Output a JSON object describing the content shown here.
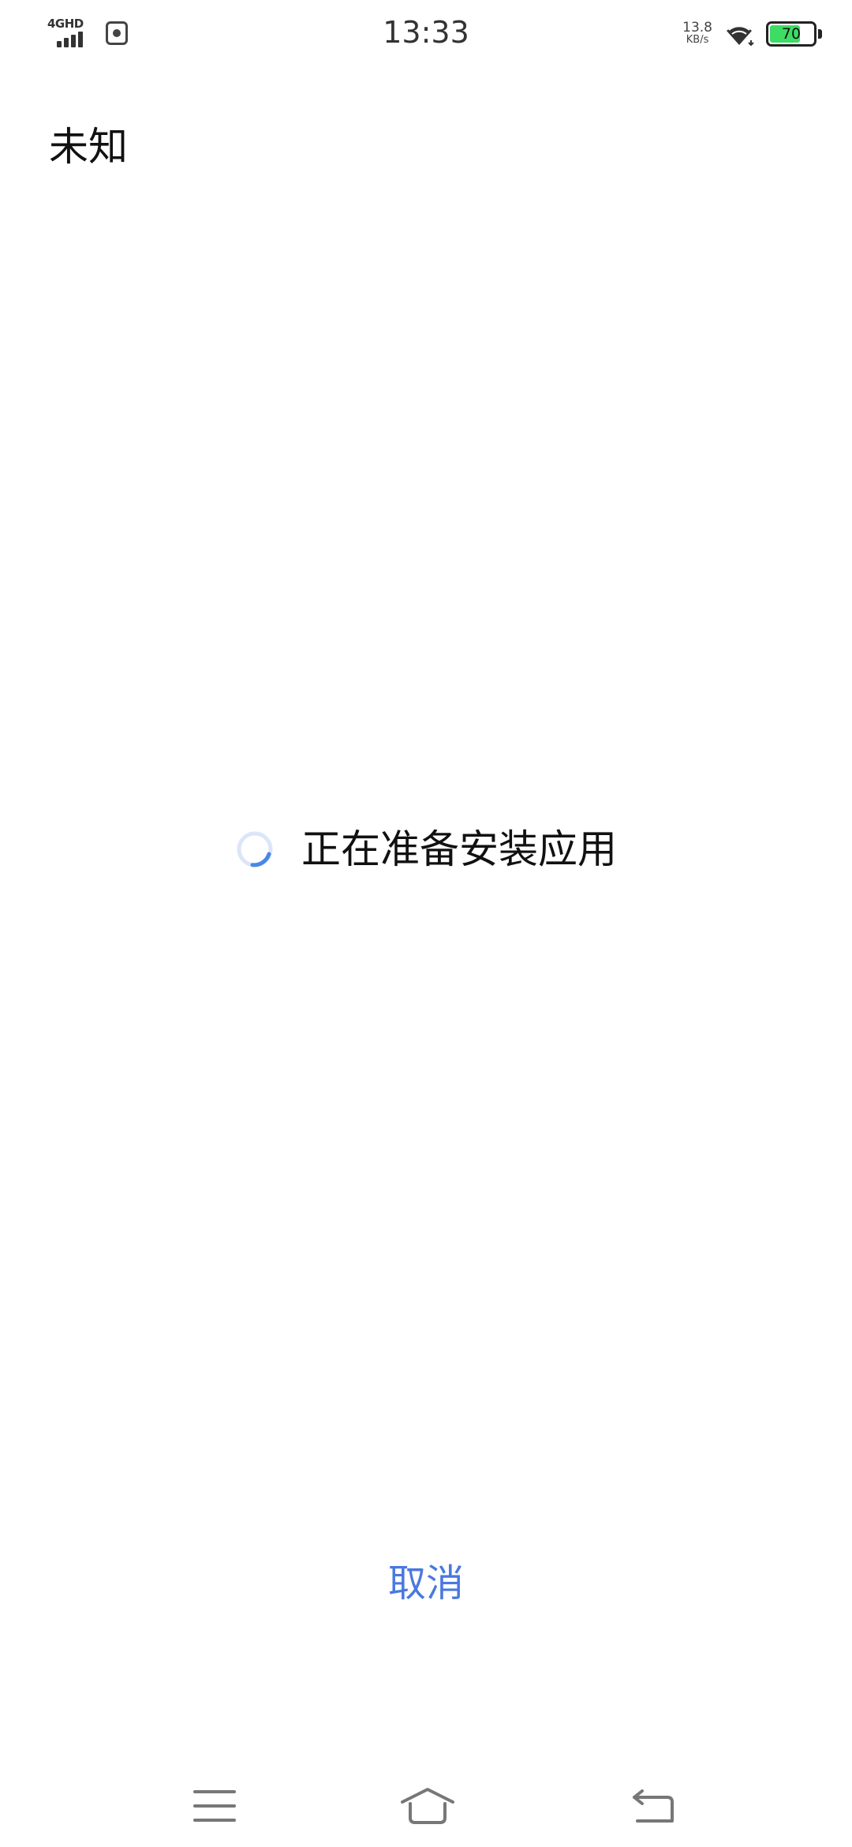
{
  "status_bar": {
    "network_type": "4GHD",
    "time": "13:33",
    "net_speed_value": "13.8",
    "net_speed_unit": "KB/s",
    "battery_level": "70",
    "battery_fraction": 0.7,
    "battery_color": "#3ddc64"
  },
  "installer": {
    "app_name": "未知",
    "progress_message": "正在准备安装应用",
    "cancel_label": "取消",
    "accent_color": "#4a78e0"
  },
  "nav_bar": {
    "icons": [
      "menu-icon",
      "home-icon",
      "back-icon"
    ]
  }
}
